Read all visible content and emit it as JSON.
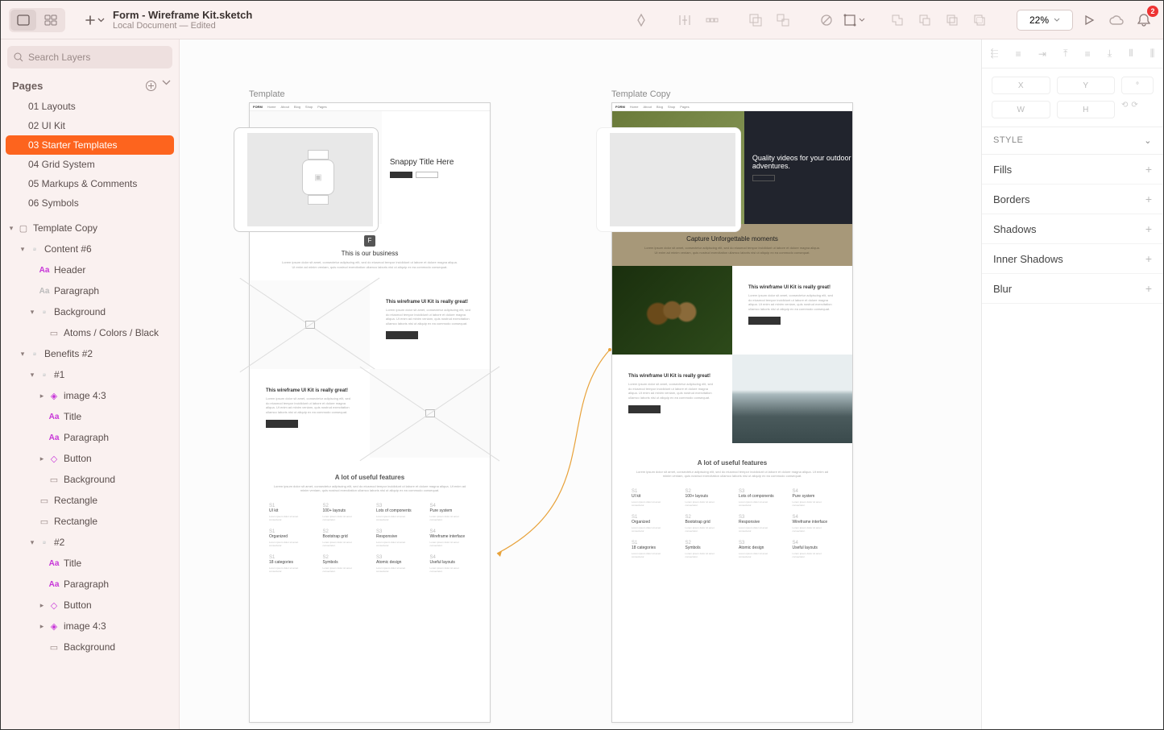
{
  "toolbar": {
    "title": "Form - Wireframe Kit.sketch",
    "subtitle": "Local Document — Edited",
    "zoom": "22%",
    "notification_count": "2"
  },
  "sidebar": {
    "search_placeholder": "Search Layers",
    "pages_label": "Pages",
    "pages": [
      "01 Layouts",
      "02 UI Kit",
      "03 Starter Templates",
      "04 Grid System",
      "05 Markups & Comments",
      "06 Symbols"
    ],
    "active_page_index": 2,
    "layers": {
      "root": "Template Copy",
      "content6": "Content #6",
      "header": "Header",
      "paragraph": "Paragraph",
      "background": "Background",
      "atoms_black": "Atoms / Colors / Black",
      "benefits2": "Benefits #2",
      "group1": "#1",
      "image43": "image 4:3",
      "title": "Title",
      "button": "Button",
      "rectangle": "Rectangle",
      "group2": "#2"
    }
  },
  "canvas": {
    "artboard1_label": "Template",
    "artboard2_label": "Template Copy",
    "navbar_brand": "FORM",
    "template": {
      "hero_title": "Snappy Title Here",
      "content_title": "This is our business",
      "lorem": "Lorem ipsum dolor sit amet, consectetur adipiscing elit, sed do eiusmod tempor incididunt ut labore et dolore magna aliqua. Ut enim ad minim veniam, quis nostrud exercitation ullamco laboris nisi ut aliquip ex ea commodo consequat.",
      "benefit_title": "This wireframe UI Kit is really great!",
      "features_title": "A lot of useful features",
      "feature_items": [
        {
          "n": "S1",
          "t": "UI kit"
        },
        {
          "n": "S2",
          "t": "100+ layouts"
        },
        {
          "n": "S3",
          "t": "Lots of components"
        },
        {
          "n": "S4",
          "t": "Pure system"
        },
        {
          "n": "S1",
          "t": "Organized"
        },
        {
          "n": "S2",
          "t": "Bootstrap grid"
        },
        {
          "n": "S3",
          "t": "Responsive"
        },
        {
          "n": "S4",
          "t": "Wireframe interface"
        },
        {
          "n": "S1",
          "t": "18 categories"
        },
        {
          "n": "S2",
          "t": "Symbols"
        },
        {
          "n": "S3",
          "t": "Atomic design"
        },
        {
          "n": "S4",
          "t": "Useful layouts"
        }
      ]
    },
    "template_copy": {
      "hero_title": "Quality videos for your outdoor adventures.",
      "content_title": "Capture Unforgettable moments"
    }
  },
  "inspector": {
    "pos_labels": {
      "x": "X",
      "y": "Y",
      "w": "W",
      "h": "H",
      "rot": "°"
    },
    "style_label": "STYLE",
    "rows": [
      "Fills",
      "Borders",
      "Shadows",
      "Inner Shadows",
      "Blur"
    ]
  }
}
